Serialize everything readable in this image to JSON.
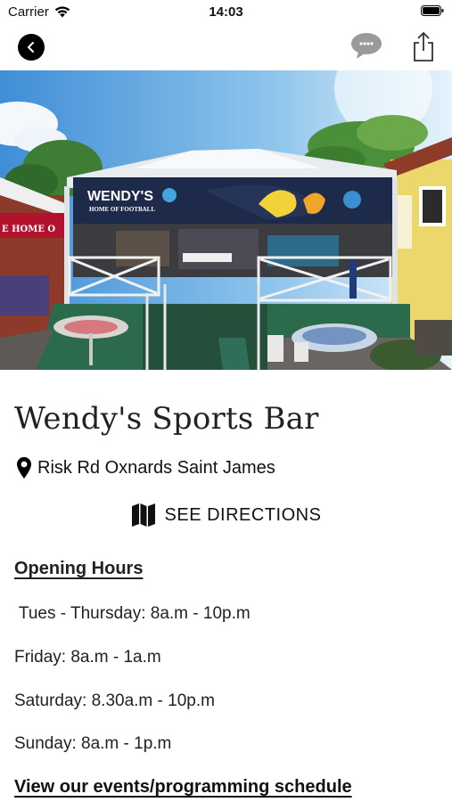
{
  "status_bar": {
    "carrier": "Carrier",
    "time": "14:03"
  },
  "nav": {
    "back_icon": "chevron-left-icon",
    "chat_icon": "chat-bubble-icon",
    "share_icon": "share-icon"
  },
  "hero": {
    "sign_line1": "WENDY'S",
    "sign_line2": "HOME OF FOOTBALL",
    "side_sign": "E HOME O"
  },
  "venue": {
    "title": "Wendy's Sports Bar",
    "address": "Risk Rd Oxnards Saint James",
    "directions_label": "SEE DIRECTIONS",
    "opening_hours_heading": "Opening Hours",
    "hours": [
      " Tues - Thursday: 8a.m - 10p.m",
      "Friday: 8a.m - 1a.m",
      "Saturday: 8.30a.m - 10p.m",
      "Sunday: 8a.m - 1p.m"
    ],
    "events_link": "View our events/programming schedule"
  },
  "colors": {
    "text": "#222222",
    "sign_bg": "#1d2a4a",
    "banner_red": "#b3122e",
    "house_yellow": "#ecd86a"
  }
}
